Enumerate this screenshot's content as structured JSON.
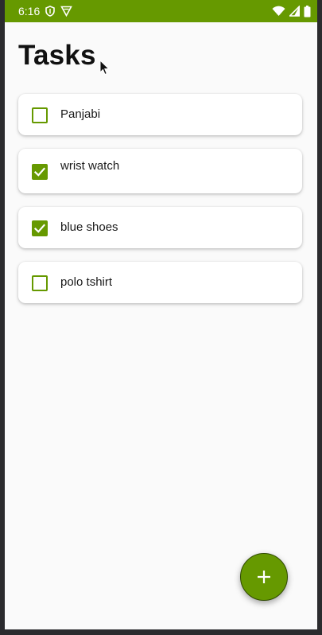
{
  "status_bar": {
    "time": "6:16",
    "left_icons": [
      "shield-icon",
      "vpn-icon"
    ],
    "right_icons": [
      "wifi-icon",
      "signal-icon",
      "battery-icon"
    ],
    "color": "#669900"
  },
  "header": {
    "title": "Tasks"
  },
  "tasks": [
    {
      "label": "Panjabi",
      "checked": false
    },
    {
      "label": "wrist watch",
      "checked": true
    },
    {
      "label": "blue shoes",
      "checked": true
    },
    {
      "label": "polo tshirt",
      "checked": false
    }
  ],
  "fab": {
    "icon": "plus-icon",
    "color": "#669900"
  },
  "colors": {
    "accent": "#669900",
    "background": "#fafafa",
    "card": "#ffffff"
  }
}
